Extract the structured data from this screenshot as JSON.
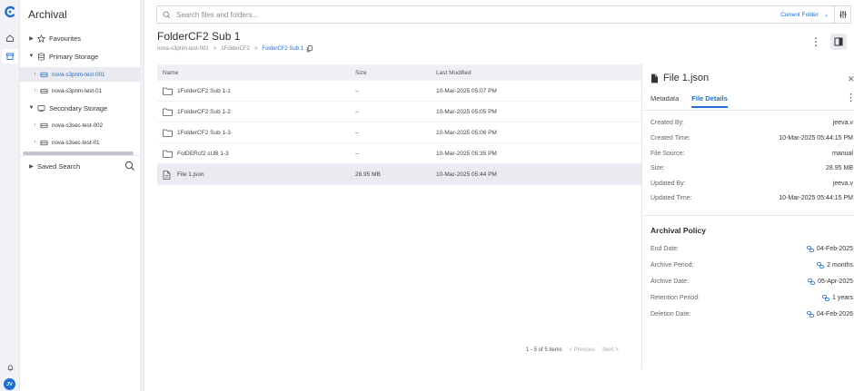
{
  "sidebar": {
    "title": "Archival",
    "items": [
      {
        "label": "Favourites"
      },
      {
        "label": "Primary Storage"
      },
      {
        "label": "nova-s3prim-test-001"
      },
      {
        "label": "nova-s3prim-test-01"
      },
      {
        "label": "Secondary Storage"
      },
      {
        "label": "nova-s3sec-test-002"
      },
      {
        "label": "nova-s3sec-test-01"
      },
      {
        "label": "Saved Search"
      }
    ]
  },
  "rail": {
    "avatar": "JV"
  },
  "search": {
    "placeholder": "Search files and folders...",
    "scope": "Current Folder"
  },
  "header": {
    "title": "FolderCF2 Sub 1",
    "breadcrumb": [
      "nova-s3prim-test-001",
      "1FolderCF2",
      "FolderCF2 Sub 1"
    ]
  },
  "table": {
    "columns": [
      "Name",
      "Size",
      "Last Modified"
    ],
    "rows": [
      {
        "name": "1FolderCF2 Sub 1-1",
        "size": "--",
        "modified": "10-Mar-2025 05:07 PM",
        "type": "folder"
      },
      {
        "name": "1FolderCF2 Sub 1-2",
        "size": "--",
        "modified": "10-Mar-2025 05:05 PM",
        "type": "folder"
      },
      {
        "name": "1FolderCF2 Sub 1-3",
        "size": "--",
        "modified": "10-Mar-2025 05:06 PM",
        "type": "folder"
      },
      {
        "name": "FolDERcf2 sUB 1-3",
        "size": "--",
        "modified": "10-Mar-2025 05:35 PM",
        "type": "folder"
      },
      {
        "name": "File 1.json",
        "size": "28.95 MB",
        "modified": "10-Mar-2025 05:44 PM",
        "type": "file"
      }
    ]
  },
  "pagination": {
    "summary": "1 - 5 of 5 items",
    "prev": "< Previous",
    "next": "Next >"
  },
  "panel": {
    "title": "File 1.json",
    "tabs": [
      "Metadata",
      "File Details"
    ],
    "details": [
      {
        "key": "Created By:",
        "value": "jeeva.v"
      },
      {
        "key": "Created Time:",
        "value": "10-Mar-2025 05:44:15 PM"
      },
      {
        "key": "File Source:",
        "value": "manual"
      },
      {
        "key": "Size:",
        "value": "28.95 MB"
      },
      {
        "key": "Updated By:",
        "value": "jeeva.v"
      },
      {
        "key": "Updated Time:",
        "value": "10-Mar-2025 05:44:15 PM"
      }
    ],
    "policy_title": "Archival Policy",
    "policy": [
      {
        "key": "End Date:",
        "value": "04-Feb-2025"
      },
      {
        "key": "Archive Period:",
        "value": "2 months"
      },
      {
        "key": "Archive Date:",
        "value": "05-Apr-2025"
      },
      {
        "key": "Retention Period:",
        "value": "1 years"
      },
      {
        "key": "Deletion Date:",
        "value": "04-Feb-2026"
      }
    ]
  },
  "colors": {
    "accent": "#1f6fd1",
    "selected_row": "#e9ebf0",
    "header_bg": "#eef0f3"
  }
}
